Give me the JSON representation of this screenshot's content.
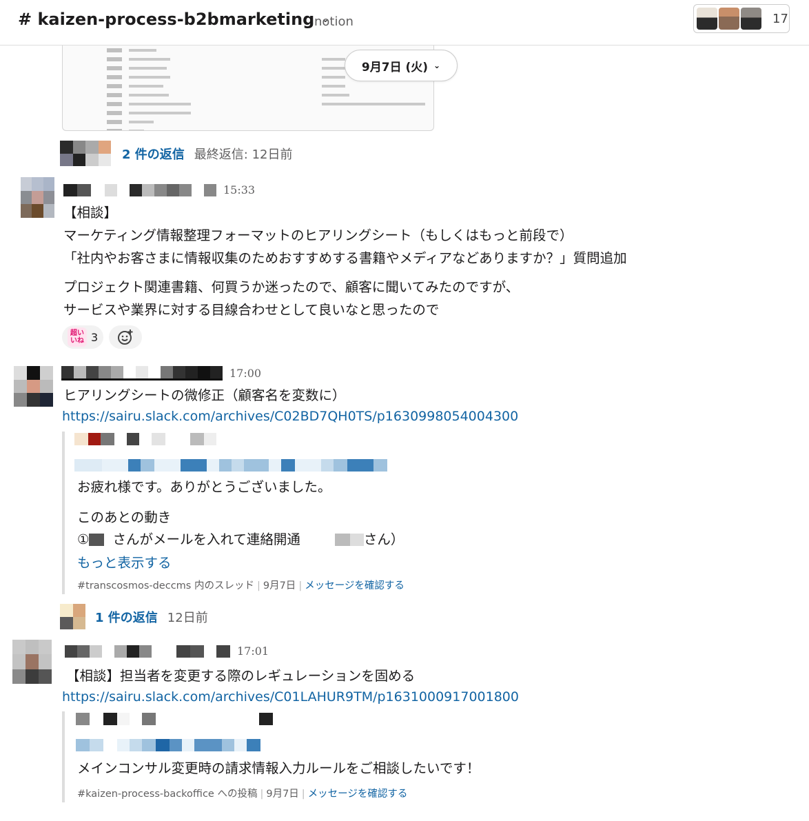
{
  "header": {
    "channel": "# kaizen-process-b2bmarketing",
    "topic": "notion",
    "member_count": "17"
  },
  "date_divider": {
    "label": "9月7日 (火)"
  },
  "thread_top": {
    "count": "2 件の返信",
    "last_reply": "最終返信: 12日前"
  },
  "message1": {
    "time": "15:33",
    "lines": [
      "【相談】",
      "マーケティング情報整理フォーマットのヒアリングシート（もしくはもっと前段で）",
      "「社内やお客さまに情報収集のためおすすめする書籍やメディアなどありますか？」質問追加"
    ],
    "lines2": [
      "プロジェクト関連書籍、何買うか迷ったので、顧客に聞いてみたのですが、",
      "サービスや業界に対する目線合わせとして良いなと思ったので"
    ],
    "reaction_count": "3",
    "reaction_emoji": "超いいね"
  },
  "message2": {
    "time": "17:00",
    "text": "ヒアリングシートの微修正（顧客名を変数に）",
    "link": "https://sairu.slack.com/archives/C02BD7QH0TS/p1630998054004300",
    "quote": {
      "line1": "お疲れ様です。ありがとうございました。",
      "line2": "このあとの動き",
      "line3a": "①",
      "line3b": "さんがメールを入れて連絡開通",
      "line3c": "さん）",
      "more": "もっと表示する",
      "source": "#transcosmos-deccms 内のスレッド",
      "date": "9月7日",
      "action": "メッセージを確認する"
    },
    "thread": {
      "count": "1 件の返信",
      "time": "12日前"
    }
  },
  "message3": {
    "time": "17:01",
    "text": "【相談】担当者を変更する際のレギュレーションを固める",
    "link": "https://sairu.slack.com/archives/C01LAHUR9TM/p1631000917001800",
    "quote": {
      "line1": "メインコンサル変更時の請求情報入力ルールをご相談したいです！",
      "source": "#kaizen-process-backoffice への投稿",
      "date": "9月7日",
      "action": "メッセージを確認する"
    }
  },
  "icons": [
    "chevron-down-icon",
    "add-reaction-icon"
  ],
  "colors": {
    "link": "#1264a3",
    "text": "#1d1c1d",
    "muted": "#616061"
  }
}
